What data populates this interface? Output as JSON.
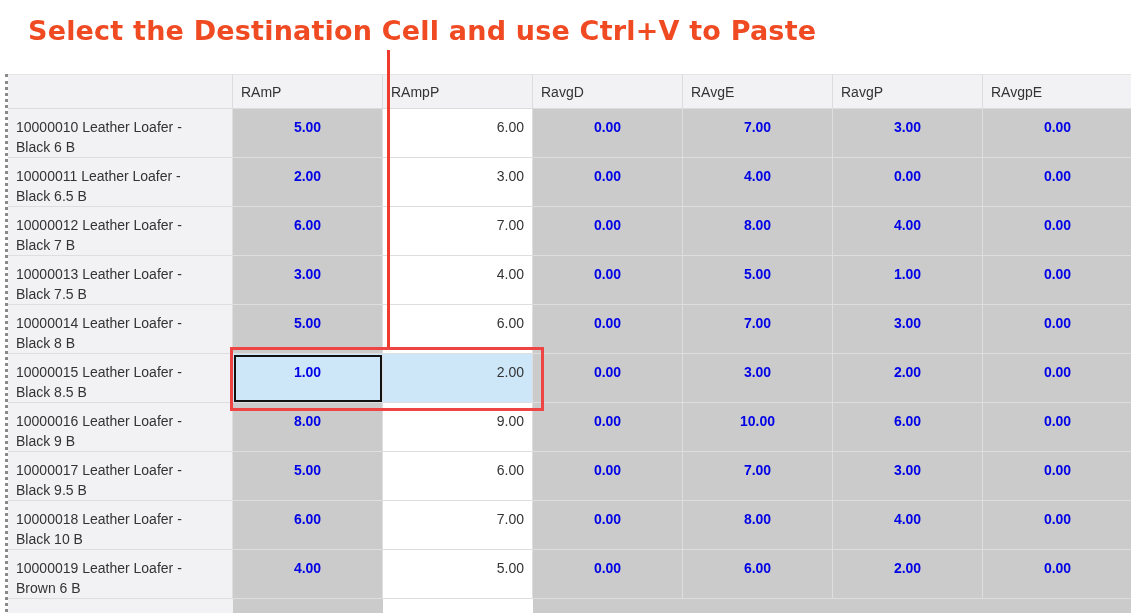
{
  "annotation": {
    "title": "Select the Destination Cell and use Ctrl+V to Paste"
  },
  "table": {
    "columns": [
      {
        "kind": "name"
      },
      {
        "label": "RAmP",
        "kind": "calc"
      },
      {
        "label": "RAmpP",
        "kind": "input"
      },
      {
        "label": "RavgD",
        "kind": "calc"
      },
      {
        "label": "RAvgE",
        "kind": "calc"
      },
      {
        "label": "RavgP",
        "kind": "calc"
      },
      {
        "label": "RAvgpE",
        "kind": "calc"
      }
    ],
    "rows": [
      {
        "name": "10000010 Leather Loafer - Black 6 B",
        "cells": [
          {
            "value": "5.00",
            "selected": false,
            "active": false
          },
          {
            "value": "6.00",
            "selected": false,
            "active": false
          },
          {
            "value": "0.00",
            "selected": false,
            "active": false
          },
          {
            "value": "7.00",
            "selected": false,
            "active": false
          },
          {
            "value": "3.00",
            "selected": false,
            "active": false
          },
          {
            "value": "0.00",
            "selected": false,
            "active": false
          }
        ]
      },
      {
        "name": "10000011 Leather Loafer - Black 6.5 B",
        "cells": [
          {
            "value": "2.00",
            "selected": false,
            "active": false
          },
          {
            "value": "3.00",
            "selected": false,
            "active": false
          },
          {
            "value": "0.00",
            "selected": false,
            "active": false
          },
          {
            "value": "4.00",
            "selected": false,
            "active": false
          },
          {
            "value": "0.00",
            "selected": false,
            "active": false
          },
          {
            "value": "0.00",
            "selected": false,
            "active": false
          }
        ]
      },
      {
        "name": "10000012 Leather Loafer - Black 7 B",
        "cells": [
          {
            "value": "6.00",
            "selected": false,
            "active": false
          },
          {
            "value": "7.00",
            "selected": false,
            "active": false
          },
          {
            "value": "0.00",
            "selected": false,
            "active": false
          },
          {
            "value": "8.00",
            "selected": false,
            "active": false
          },
          {
            "value": "4.00",
            "selected": false,
            "active": false
          },
          {
            "value": "0.00",
            "selected": false,
            "active": false
          }
        ]
      },
      {
        "name": "10000013 Leather Loafer - Black 7.5 B",
        "cells": [
          {
            "value": "3.00",
            "selected": false,
            "active": false
          },
          {
            "value": "4.00",
            "selected": false,
            "active": false
          },
          {
            "value": "0.00",
            "selected": false,
            "active": false
          },
          {
            "value": "5.00",
            "selected": false,
            "active": false
          },
          {
            "value": "1.00",
            "selected": false,
            "active": false
          },
          {
            "value": "0.00",
            "selected": false,
            "active": false
          }
        ]
      },
      {
        "name": "10000014 Leather Loafer - Black 8 B",
        "cells": [
          {
            "value": "5.00",
            "selected": false,
            "active": false
          },
          {
            "value": "6.00",
            "selected": false,
            "active": false
          },
          {
            "value": "0.00",
            "selected": false,
            "active": false
          },
          {
            "value": "7.00",
            "selected": false,
            "active": false
          },
          {
            "value": "3.00",
            "selected": false,
            "active": false
          },
          {
            "value": "0.00",
            "selected": false,
            "active": false
          }
        ]
      },
      {
        "name": "10000015 Leather Loafer - Black 8.5 B",
        "cells": [
          {
            "value": "1.00",
            "selected": true,
            "active": true
          },
          {
            "value": "2.00",
            "selected": true,
            "active": false
          },
          {
            "value": "0.00",
            "selected": false,
            "active": false
          },
          {
            "value": "3.00",
            "selected": false,
            "active": false
          },
          {
            "value": "2.00",
            "selected": false,
            "active": false
          },
          {
            "value": "0.00",
            "selected": false,
            "active": false
          }
        ]
      },
      {
        "name": "10000016 Leather Loafer - Black 9 B",
        "cells": [
          {
            "value": "8.00",
            "selected": false,
            "active": false
          },
          {
            "value": "9.00",
            "selected": false,
            "active": false
          },
          {
            "value": "0.00",
            "selected": false,
            "active": false
          },
          {
            "value": "10.00",
            "selected": false,
            "active": false
          },
          {
            "value": "6.00",
            "selected": false,
            "active": false
          },
          {
            "value": "0.00",
            "selected": false,
            "active": false
          }
        ]
      },
      {
        "name": "10000017 Leather Loafer - Black 9.5 B",
        "cells": [
          {
            "value": "5.00",
            "selected": false,
            "active": false
          },
          {
            "value": "6.00",
            "selected": false,
            "active": false
          },
          {
            "value": "0.00",
            "selected": false,
            "active": false
          },
          {
            "value": "7.00",
            "selected": false,
            "active": false
          },
          {
            "value": "3.00",
            "selected": false,
            "active": false
          },
          {
            "value": "0.00",
            "selected": false,
            "active": false
          }
        ]
      },
      {
        "name": "10000018 Leather Loafer - Black 10 B",
        "cells": [
          {
            "value": "6.00",
            "selected": false,
            "active": false
          },
          {
            "value": "7.00",
            "selected": false,
            "active": false
          },
          {
            "value": "0.00",
            "selected": false,
            "active": false
          },
          {
            "value": "8.00",
            "selected": false,
            "active": false
          },
          {
            "value": "4.00",
            "selected": false,
            "active": false
          },
          {
            "value": "0.00",
            "selected": false,
            "active": false
          }
        ]
      },
      {
        "name": "10000019 Leather Loafer - Brown 6 B",
        "cells": [
          {
            "value": "4.00",
            "selected": false,
            "active": false
          },
          {
            "value": "5.00",
            "selected": false,
            "active": false
          },
          {
            "value": "0.00",
            "selected": false,
            "active": false
          },
          {
            "value": "6.00",
            "selected": false,
            "active": false
          },
          {
            "value": "2.00",
            "selected": false,
            "active": false
          },
          {
            "value": "0.00",
            "selected": false,
            "active": false
          }
        ]
      }
    ]
  }
}
